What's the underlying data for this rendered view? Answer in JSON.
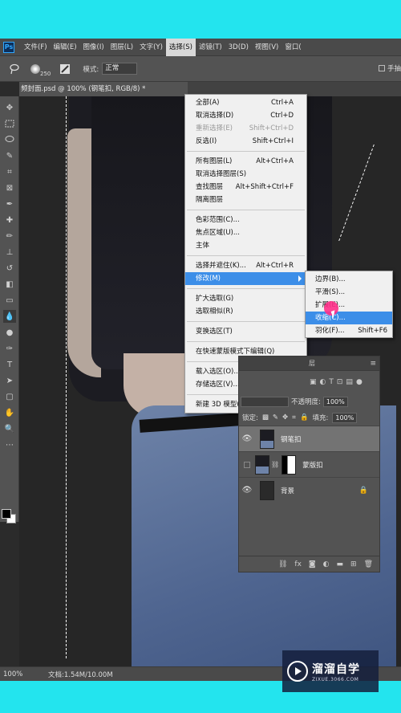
{
  "menubar": {
    "logo": "Ps",
    "items": [
      "文件(F)",
      "编辑(E)",
      "图像(I)",
      "图层(L)",
      "文字(Y)",
      "选择(S)",
      "滤镜(T)",
      "3D(D)",
      "视图(V)",
      "窗口("
    ],
    "active_index": 5
  },
  "options": {
    "brush_size": "250",
    "mode_label": "模式:",
    "mode_value": "正常",
    "right_text": "手抽"
  },
  "document": {
    "tab_title": "频封面.psd @ 100% (钢笔扣, RGB/8) *"
  },
  "select_menu": {
    "items": [
      {
        "label": "全部(A)",
        "shortcut": "Ctrl+A",
        "disabled": false
      },
      {
        "label": "取消选择(D)",
        "shortcut": "Ctrl+D",
        "disabled": false
      },
      {
        "label": "重新选择(E)",
        "shortcut": "Shift+Ctrl+D",
        "disabled": true
      },
      {
        "label": "反选(I)",
        "shortcut": "Shift+Ctrl+I",
        "disabled": false
      },
      {
        "label": "所有图层(L)",
        "shortcut": "Alt+Ctrl+A",
        "disabled": false
      },
      {
        "label": "取消选择图层(S)",
        "shortcut": "",
        "disabled": false
      },
      {
        "label": "查找图层",
        "shortcut": "Alt+Shift+Ctrl+F",
        "disabled": false
      },
      {
        "label": "隔离图层",
        "shortcut": "",
        "disabled": false
      },
      {
        "label": "色彩范围(C)...",
        "shortcut": "",
        "disabled": false
      },
      {
        "label": "焦点区域(U)...",
        "shortcut": "",
        "disabled": false
      },
      {
        "label": "主体",
        "shortcut": "",
        "disabled": false
      },
      {
        "label": "选择并遮住(K)...",
        "shortcut": "Alt+Ctrl+R",
        "disabled": false
      },
      {
        "label": "修改(M)",
        "shortcut": "",
        "disabled": false
      },
      {
        "label": "扩大选取(G)",
        "shortcut": "",
        "disabled": false
      },
      {
        "label": "选取相似(R)",
        "shortcut": "",
        "disabled": false
      },
      {
        "label": "变换选区(T)",
        "shortcut": "",
        "disabled": false
      },
      {
        "label": "在快速蒙版模式下编辑(Q)",
        "shortcut": "",
        "disabled": false
      },
      {
        "label": "载入选区(O)...",
        "shortcut": "",
        "disabled": false
      },
      {
        "label": "存储选区(V)...",
        "shortcut": "",
        "disabled": false
      },
      {
        "label": "新建 3D 模型(3)",
        "shortcut": "",
        "disabled": false
      }
    ]
  },
  "modify_submenu": {
    "items": [
      {
        "label": "边界(B)...",
        "shortcut": ""
      },
      {
        "label": "平滑(S)...",
        "shortcut": ""
      },
      {
        "label": "扩展(E)...",
        "shortcut": ""
      },
      {
        "label": "收缩(C)...",
        "shortcut": ""
      },
      {
        "label": "羽化(F)...",
        "shortcut": "Shift+F6"
      }
    ],
    "highlighted_index": 3
  },
  "layers_panel": {
    "tab_label": "层",
    "opacity_label": "不透明度:",
    "opacity_value": "100%",
    "lock_label": "锁定:",
    "fill_label": "填充:",
    "fill_value": "100%",
    "layers": [
      {
        "name": "钢笔扣",
        "visible": true,
        "selected": true
      },
      {
        "name": "蒙版扣",
        "visible": false,
        "selected": false
      },
      {
        "name": "背景",
        "visible": true,
        "selected": false
      }
    ]
  },
  "status": {
    "zoom": "100%",
    "doc_info": "文档:1.54M/10.00M"
  },
  "watermark": {
    "title": "溜溜自学",
    "subtitle": "ZIXUE.3066.COM"
  },
  "colors": {
    "frame": "#23e4ee",
    "highlight": "#3c8ee8",
    "cursor_dot": "#ff2f8a"
  }
}
